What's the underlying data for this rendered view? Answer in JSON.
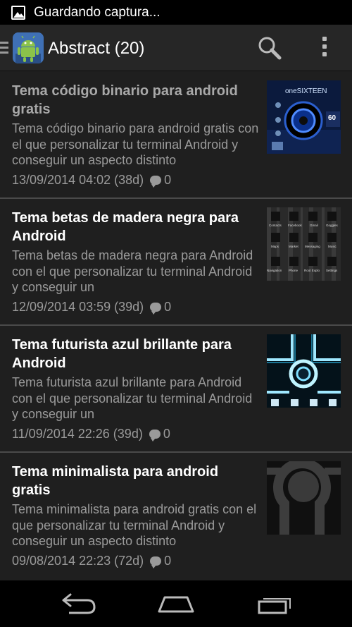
{
  "status_bar": {
    "text": "Guardando captura..."
  },
  "action_bar": {
    "title": "Abstract (20)"
  },
  "items": [
    {
      "title": "Tema código binario para android gratis",
      "summary": "Tema código binario para android gratis con el que personalizar tu terminal Android y conseguir un aspecto distinto",
      "date": "13/09/2014 04:02 (38d)",
      "comments": "0",
      "read": true,
      "thumb": {
        "brand": "oneSIXTEEN",
        "number": "60"
      }
    },
    {
      "title": "Tema betas de madera negra para Android",
      "summary": "Tema betas de madera negra para Android con el que personalizar tu terminal Android y conseguir un",
      "date": "12/09/2014 03:59 (39d)",
      "comments": "0",
      "read": false,
      "thumb": {
        "labels": [
          "Contacts",
          "Facebook",
          "Gmail",
          "Goggles",
          "Maps",
          "Market",
          "Messaging",
          "Music",
          "Navigation",
          "Phone",
          "Root Explo",
          "Settings"
        ]
      }
    },
    {
      "title": "Tema futurista azul brillante para Android",
      "summary": "Tema futurista azul brillante para Android con el que personalizar tu terminal Android y conseguir un",
      "date": "11/09/2014 22:26 (39d)",
      "comments": "0",
      "read": false
    },
    {
      "title": "Tema minimalista para android gratis",
      "summary": "Tema minimalista para android gratis con el que personalizar tu terminal Android y conseguir un aspecto distinto",
      "date": "09/08/2014 22:23 (72d)",
      "comments": "0",
      "read": false
    }
  ],
  "colors": {
    "background": "#1f1f1f",
    "action_bar": "#262626",
    "divider": "#4a4a4a",
    "read_title": "#a8a8a8",
    "secondary_text": "#9a9a9a"
  }
}
